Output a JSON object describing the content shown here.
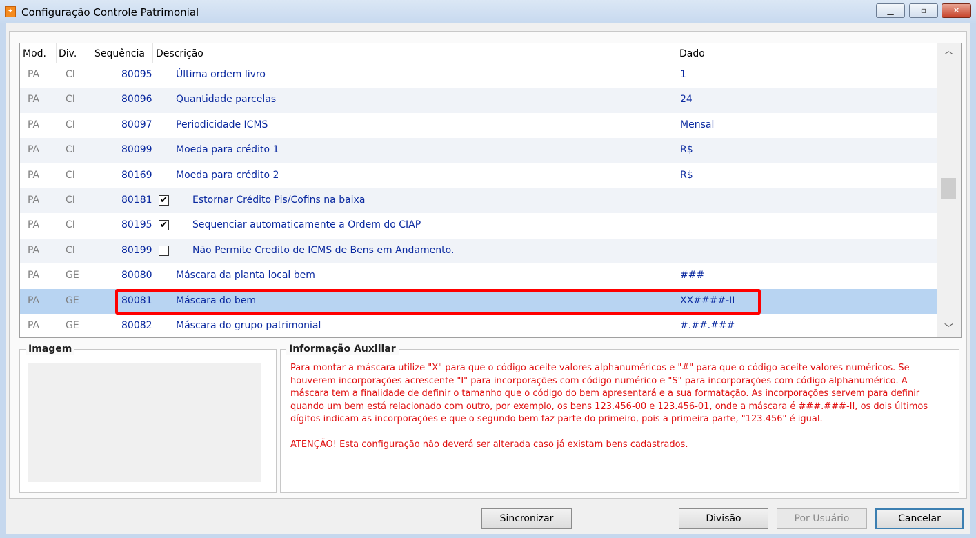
{
  "window": {
    "title": "Configuração Controle Patrimonial",
    "icon": "app-icon",
    "controls": {
      "minimize": "▁",
      "maximize": "▫",
      "close": "✕"
    }
  },
  "grid": {
    "columns": {
      "mod": "Mod.",
      "div": "Div.",
      "seq": "Sequência",
      "desc": "Descrição",
      "dado": "Dado"
    },
    "rows": [
      {
        "mod": "PA",
        "div": "CI",
        "seq": "80095",
        "desc": "Última ordem livro",
        "dado": "1"
      },
      {
        "mod": "PA",
        "div": "CI",
        "seq": "80096",
        "desc": "Quantidade parcelas",
        "dado": "24"
      },
      {
        "mod": "PA",
        "div": "CI",
        "seq": "80097",
        "desc": "Periodicidade ICMS",
        "dado": "Mensal"
      },
      {
        "mod": "PA",
        "div": "CI",
        "seq": "80099",
        "desc": "Moeda para crédito 1",
        "dado": "R$"
      },
      {
        "mod": "PA",
        "div": "CI",
        "seq": "80169",
        "desc": "Moeda para crédito 2",
        "dado": "R$"
      },
      {
        "mod": "PA",
        "div": "CI",
        "seq": "80181",
        "desc": "Estornar Crédito Pis/Cofins na baixa",
        "dado": "",
        "checkbox": true,
        "checked": true
      },
      {
        "mod": "PA",
        "div": "CI",
        "seq": "80195",
        "desc": "Sequenciar automaticamente a Ordem do CIAP",
        "dado": "",
        "checkbox": true,
        "checked": true
      },
      {
        "mod": "PA",
        "div": "CI",
        "seq": "80199",
        "desc": "Não Permite Credito de ICMS de Bens em Andamento.",
        "dado": "",
        "checkbox": true,
        "checked": false
      },
      {
        "mod": "PA",
        "div": "GE",
        "seq": "80080",
        "desc": "Máscara da planta local bem",
        "dado": "###"
      },
      {
        "mod": "PA",
        "div": "GE",
        "seq": "80081",
        "desc": "Máscara do bem",
        "dado": "XX####-II",
        "selected": true
      },
      {
        "mod": "PA",
        "div": "GE",
        "seq": "80082",
        "desc": "Máscara do grupo patrimonial",
        "dado": "#.##.###"
      }
    ],
    "scrollbar": {
      "up": "︿",
      "down": "﹀"
    }
  },
  "image_panel": {
    "title": "Imagem"
  },
  "info_panel": {
    "title": "Informação Auxiliar",
    "paragraph1": "Para montar a máscara utilize \"X\" para que o código aceite valores alphanuméricos e \"#\" para que o código aceite valores numéricos. Se houverem incorporações acrescente \"I\" para incorporações com código numérico e \"S\" para incorporações com código alphanumérico. A máscara tem a finalidade de definir o tamanho que o código do bem apresentará e a sua formatação. As incorporações servem para definir quando um bem está relacionado com outro, por exemplo, os bens 123.456-00 e 123.456-01, onde a máscara é ###.###-II, os dois últimos dígitos indicam as incorporações e que o segundo bem faz parte do primeiro, pois a primeira parte, \"123.456\" é igual.",
    "paragraph2": "ATENÇÃO! Esta  configuração não deverá ser alterada caso já existam bens cadastrados.",
    "text_color": "#e01010"
  },
  "buttons": {
    "sync": "Sincronizar",
    "divisao": "Divisão",
    "usuario": "Por Usuário",
    "cancel": "Cancelar"
  },
  "colors": {
    "selected_row": "#b8d4f2",
    "highlight_border": "#ff0000",
    "row_text": "#0b2aa0"
  }
}
